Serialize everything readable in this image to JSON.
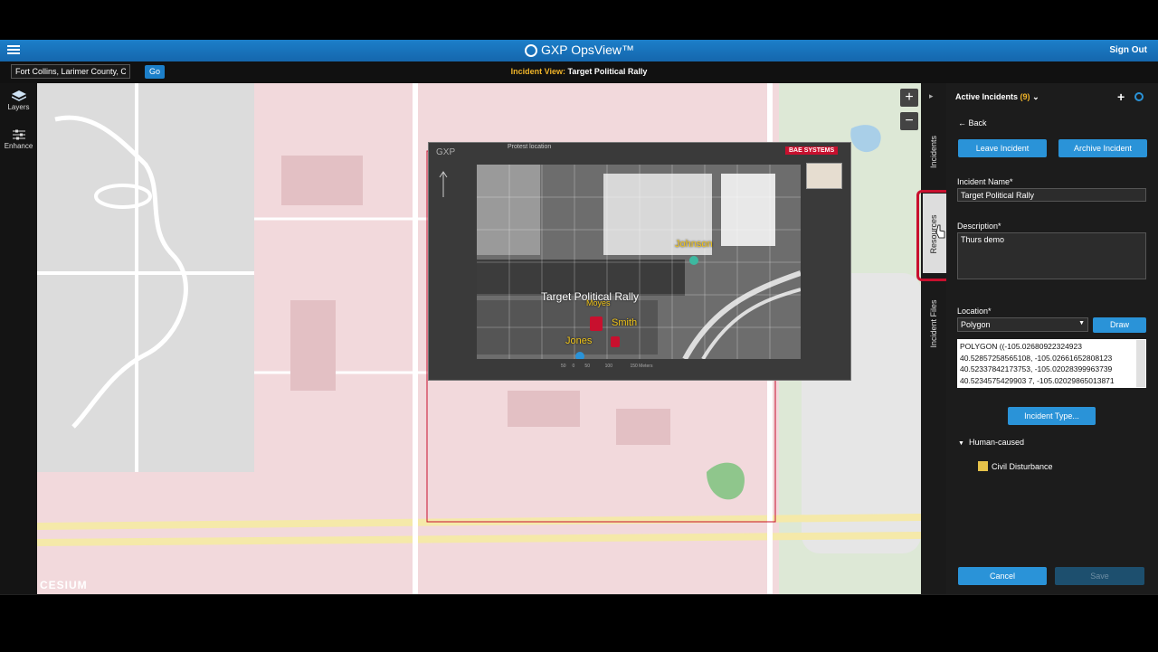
{
  "header": {
    "app_title": "GXP OpsView™",
    "sign_out": "Sign Out"
  },
  "toolbar": {
    "location_value": "Fort Collins, Larimer County, Colorado",
    "go_label": "Go",
    "incident_view_label": "Incident View:",
    "incident_view_name": "Target Political Rally"
  },
  "tools": [
    {
      "label": "Layers",
      "icon": "layers-icon"
    },
    {
      "label": "Enhance",
      "icon": "enhance-sliders-icon"
    }
  ],
  "map": {
    "zoom_in": "+",
    "zoom_out": "−",
    "provider": "CESIUM",
    "overlay": {
      "app": "GXP",
      "title": "Protest location",
      "brand": "BAE SYSTEMS",
      "incident_label": "Target Political Rally",
      "names": [
        "Johnson",
        "Moyes",
        "Smith",
        "Jones"
      ],
      "scale_labels": [
        "50",
        "0",
        "50",
        "100",
        "150 Meters"
      ]
    }
  },
  "vertical_tabs": [
    "Incidents",
    "Resources",
    "Incident Files"
  ],
  "panel": {
    "header": "Active Incidents",
    "count": "(9)",
    "back": "Back",
    "leave_btn": "Leave Incident",
    "archive_btn": "Archive Incident",
    "name_label": "Incident Name",
    "name_value": "Target Political Rally",
    "desc_label": "Description",
    "desc_value": "Thurs demo",
    "location_label": "Location",
    "location_type": "Polygon",
    "draw_btn": "Draw",
    "polygon_lines": [
      "POLYGON ((-105.02680922324923",
      "40.52857258565108, -105.02661652808123",
      "40.52337842173753, -105.02028399963739",
      "40.5234575429903 7, -105.02029865013871"
    ],
    "incident_type_btn": "Incident Type...",
    "category": "Human-caused",
    "type_item": "Civil Disturbance",
    "cancel_btn": "Cancel",
    "save_btn": "Save"
  },
  "colors": {
    "accent": "#2a93d8",
    "header_blue": "#1c7fc9",
    "highlight_red": "#c8102e",
    "warning_yellow": "#f0b429"
  }
}
